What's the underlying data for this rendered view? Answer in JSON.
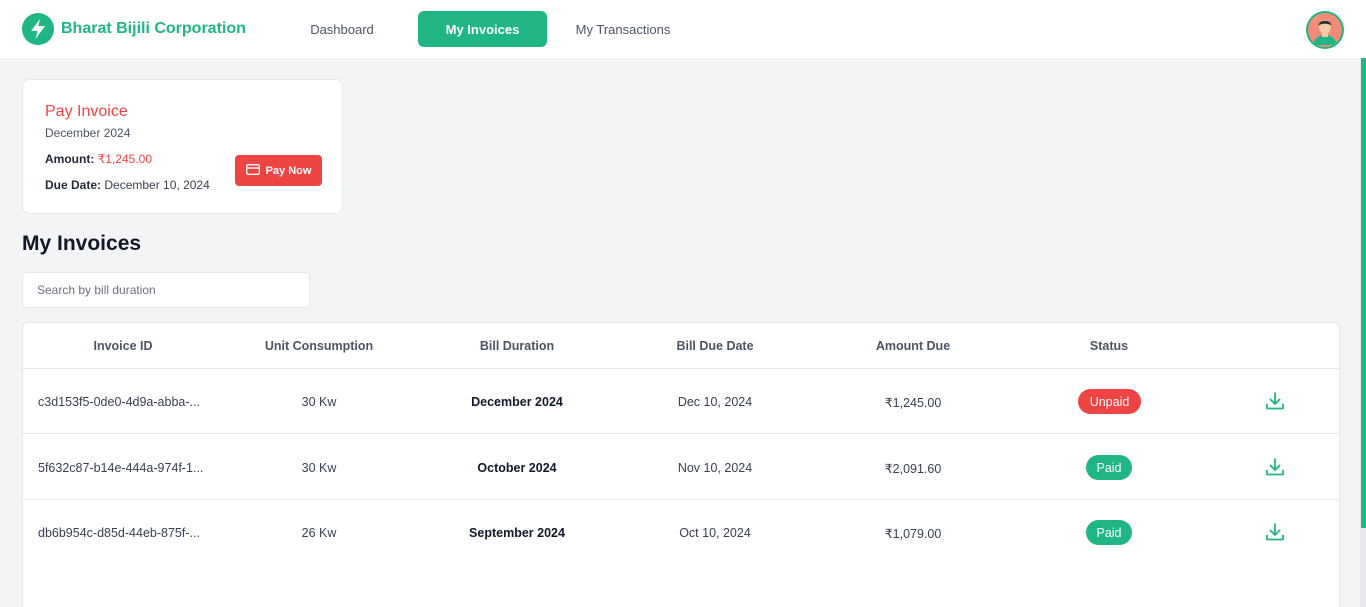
{
  "nav": {
    "brand": "Bharat Bijili Corporation",
    "links": [
      "Dashboard",
      "My Invoices",
      "My Transactions"
    ],
    "active": "My Invoices"
  },
  "pay_card": {
    "title": "Pay Invoice",
    "period": "December 2024",
    "amount_label": "Amount:",
    "amount": "₹1,245.00",
    "due_label": "Due Date:",
    "due": "December 10, 2024",
    "button": "Pay Now"
  },
  "section_title": "My Invoices",
  "search": {
    "placeholder": "Search by bill duration",
    "value": ""
  },
  "table": {
    "columns": [
      "Invoice ID",
      "Unit Consumption",
      "Bill Duration",
      "Bill Due Date",
      "Amount Due",
      "Status"
    ],
    "rows": [
      {
        "id": "c3d153f5-0de0-4d9a-abba-...",
        "units": "30 Kw",
        "duration": "December 2024",
        "due": "Dec 10, 2024",
        "amount": "₹1,245.00",
        "status": "Unpaid"
      },
      {
        "id": "5f632c87-b14e-444a-974f-1...",
        "units": "30 Kw",
        "duration": "October 2024",
        "due": "Nov 10, 2024",
        "amount": "₹2,091.60",
        "status": "Paid"
      },
      {
        "id": "db6b954c-d85d-44eb-875f-...",
        "units": "26 Kw",
        "duration": "September 2024",
        "due": "Oct 10, 2024",
        "amount": "₹1,079.00",
        "status": "Paid"
      }
    ]
  },
  "colors": {
    "brand": "#1fb584",
    "danger": "#ef4444"
  },
  "icons": {
    "logo": "lightning-bolt-icon",
    "avatar": "user-avatar-icon",
    "pay": "credit-card-icon",
    "download": "download-icon"
  }
}
